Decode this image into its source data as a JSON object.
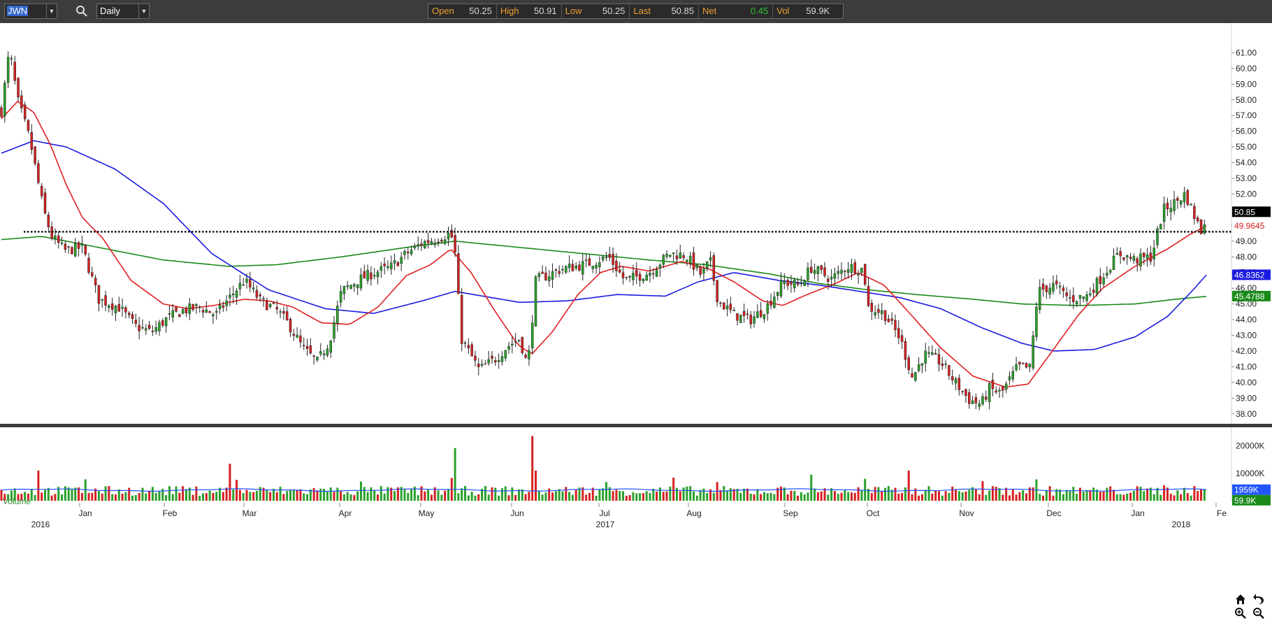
{
  "toolbar": {
    "symbol": "JWN",
    "interval": "Daily",
    "icons": {
      "symbol_dropdown": "chevron-down-icon",
      "search": "search-icon",
      "interval_dropdown": "chevron-down-icon"
    }
  },
  "quote": {
    "open_label": "Open",
    "open": "50.25",
    "high_label": "High",
    "high": "50.91",
    "low_label": "Low",
    "low": "50.25",
    "last_label": "Last",
    "last": "50.85",
    "net_label": "Net",
    "net": "0.45",
    "vol_label": "Vol",
    "vol": "59.9K"
  },
  "colors": {
    "up_candle": "#2aa02a",
    "down_candle": "#d62020",
    "ma_fast": "#e02020",
    "ma_mid": "#1a1ae0",
    "ma_slow": "#1a8a1a",
    "net_positive": "#35c035",
    "volume_avg": "#2255ff"
  },
  "nav": {
    "home": "home-icon",
    "zoom_in": "zoom-in-icon",
    "zoom_out": "zoom-out-icon",
    "undo": "undo-icon"
  },
  "chart_data": {
    "type": "candlestick",
    "ylim": [
      37.5,
      62
    ],
    "yticks": [
      "61.00",
      "60.00",
      "59.00",
      "58.00",
      "57.00",
      "56.00",
      "55.00",
      "54.00",
      "53.00",
      "52.00",
      "51.00",
      "50.00",
      "49.00",
      "48.00",
      "47.00",
      "46.00",
      "45.00",
      "44.00",
      "43.00",
      "42.00",
      "41.00",
      "40.00",
      "39.00",
      "38.00"
    ],
    "date_axis": {
      "months": [
        "Jan",
        "Feb",
        "Mar",
        "Apr",
        "May",
        "Jun",
        "Jul",
        "Aug",
        "Sep",
        "Oct",
        "Nov",
        "Dec",
        "Jan",
        "Fe"
      ],
      "years": [
        "2016",
        "2017",
        "2018"
      ]
    },
    "horizontal_line": 49.6,
    "tags": [
      {
        "value": 50.85,
        "text": "50.85",
        "bg": "#000000",
        "fg": "#ffffff"
      },
      {
        "value": 49.9645,
        "text": "49.9645",
        "bg": "#ffffff",
        "fg": "#d62020"
      },
      {
        "value": 46.8362,
        "text": "46.8362",
        "bg": "#1a1ae0",
        "fg": "#ffffff"
      },
      {
        "value": 45.4788,
        "text": "45.4788",
        "bg": "#1a8a1a",
        "fg": "#ffffff"
      }
    ],
    "price_anchors": [
      {
        "t": 0,
        "c": 57.3
      },
      {
        "t": 10,
        "c": 61.2
      },
      {
        "t": 20,
        "c": 58.0
      },
      {
        "t": 35,
        "c": 55.5
      },
      {
        "t": 52,
        "c": 51.0
      },
      {
        "t": 62,
        "c": 49.3
      },
      {
        "t": 78,
        "c": 48.4
      },
      {
        "t": 100,
        "c": 48.6
      },
      {
        "t": 120,
        "c": 45.3
      },
      {
        "t": 145,
        "c": 44.8
      },
      {
        "t": 165,
        "c": 43.6
      },
      {
        "t": 185,
        "c": 43.2
      },
      {
        "t": 205,
        "c": 44.1
      },
      {
        "t": 225,
        "c": 44.6
      },
      {
        "t": 245,
        "c": 44.8
      },
      {
        "t": 265,
        "c": 44.3
      },
      {
        "t": 285,
        "c": 45.6
      },
      {
        "t": 300,
        "c": 46.5
      },
      {
        "t": 320,
        "c": 45.2
      },
      {
        "t": 340,
        "c": 44.6
      },
      {
        "t": 355,
        "c": 43.7
      },
      {
        "t": 372,
        "c": 42.2
      },
      {
        "t": 390,
        "c": 41.3
      },
      {
        "t": 405,
        "c": 42.6
      },
      {
        "t": 420,
        "c": 45.8
      },
      {
        "t": 440,
        "c": 46.5
      },
      {
        "t": 460,
        "c": 47.0
      },
      {
        "t": 480,
        "c": 47.3
      },
      {
        "t": 500,
        "c": 48.2
      },
      {
        "t": 520,
        "c": 48.9
      },
      {
        "t": 540,
        "c": 49.2
      },
      {
        "t": 555,
        "c": 49.5
      },
      {
        "t": 560,
        "c": 48.4
      },
      {
        "t": 568,
        "c": 42.8
      },
      {
        "t": 590,
        "c": 40.8
      },
      {
        "t": 610,
        "c": 41.5
      },
      {
        "t": 625,
        "c": 42.3
      },
      {
        "t": 640,
        "c": 42.8
      },
      {
        "t": 650,
        "c": 41.0
      },
      {
        "t": 660,
        "c": 46.5
      },
      {
        "t": 690,
        "c": 47.2
      },
      {
        "t": 720,
        "c": 47.5
      },
      {
        "t": 750,
        "c": 48.0
      },
      {
        "t": 770,
        "c": 46.5
      },
      {
        "t": 800,
        "c": 47.0
      },
      {
        "t": 825,
        "c": 48.2
      },
      {
        "t": 845,
        "c": 48.1
      },
      {
        "t": 865,
        "c": 46.8
      },
      {
        "t": 875,
        "c": 47.8
      },
      {
        "t": 885,
        "c": 45.2
      },
      {
        "t": 905,
        "c": 44.3
      },
      {
        "t": 925,
        "c": 44.0
      },
      {
        "t": 945,
        "c": 44.8
      },
      {
        "t": 965,
        "c": 46.4
      },
      {
        "t": 985,
        "c": 46.2
      },
      {
        "t": 1000,
        "c": 47.3
      },
      {
        "t": 1025,
        "c": 46.6
      },
      {
        "t": 1045,
        "c": 47.4
      },
      {
        "t": 1065,
        "c": 47.2
      },
      {
        "t": 1070,
        "c": 44.8
      },
      {
        "t": 1090,
        "c": 44.4
      },
      {
        "t": 1110,
        "c": 42.8
      },
      {
        "t": 1125,
        "c": 40.3
      },
      {
        "t": 1140,
        "c": 41.8
      },
      {
        "t": 1160,
        "c": 41.3
      },
      {
        "t": 1175,
        "c": 40.2
      },
      {
        "t": 1195,
        "c": 38.9
      },
      {
        "t": 1210,
        "c": 38.6
      },
      {
        "t": 1220,
        "c": 39.6
      },
      {
        "t": 1235,
        "c": 39.3
      },
      {
        "t": 1255,
        "c": 41.0
      },
      {
        "t": 1270,
        "c": 40.9
      },
      {
        "t": 1280,
        "c": 45.8
      },
      {
        "t": 1300,
        "c": 46.2
      },
      {
        "t": 1320,
        "c": 45.3
      },
      {
        "t": 1340,
        "c": 45.5
      },
      {
        "t": 1360,
        "c": 46.8
      },
      {
        "t": 1380,
        "c": 48.2
      },
      {
        "t": 1400,
        "c": 47.8
      },
      {
        "t": 1420,
        "c": 48.0
      },
      {
        "t": 1435,
        "c": 51.0
      },
      {
        "t": 1450,
        "c": 51.5
      },
      {
        "t": 1462,
        "c": 52.0
      },
      {
        "t": 1475,
        "c": 50.4
      },
      {
        "t": 1482,
        "c": 49.6
      },
      {
        "t": 1488,
        "c": 50.85
      }
    ],
    "ma_fast": [
      {
        "t": 0,
        "v": 56.8
      },
      {
        "t": 20,
        "v": 57.9
      },
      {
        "t": 40,
        "v": 57.2
      },
      {
        "t": 60,
        "v": 55.2
      },
      {
        "t": 80,
        "v": 52.6
      },
      {
        "t": 100,
        "v": 50.5
      },
      {
        "t": 125,
        "v": 49.2
      },
      {
        "t": 160,
        "v": 46.5
      },
      {
        "t": 200,
        "v": 45.0
      },
      {
        "t": 230,
        "v": 44.7
      },
      {
        "t": 262,
        "v": 44.9
      },
      {
        "t": 300,
        "v": 45.3
      },
      {
        "t": 330,
        "v": 45.2
      },
      {
        "t": 360,
        "v": 44.8
      },
      {
        "t": 395,
        "v": 43.8
      },
      {
        "t": 430,
        "v": 43.7
      },
      {
        "t": 465,
        "v": 44.8
      },
      {
        "t": 500,
        "v": 46.8
      },
      {
        "t": 530,
        "v": 47.5
      },
      {
        "t": 555,
        "v": 48.5
      },
      {
        "t": 580,
        "v": 47.0
      },
      {
        "t": 610,
        "v": 44.5
      },
      {
        "t": 638,
        "v": 42.4
      },
      {
        "t": 655,
        "v": 41.8
      },
      {
        "t": 680,
        "v": 43.2
      },
      {
        "t": 712,
        "v": 45.6
      },
      {
        "t": 740,
        "v": 47.0
      },
      {
        "t": 765,
        "v": 47.4
      },
      {
        "t": 800,
        "v": 47.1
      },
      {
        "t": 840,
        "v": 47.7
      },
      {
        "t": 875,
        "v": 47.2
      },
      {
        "t": 905,
        "v": 46.4
      },
      {
        "t": 940,
        "v": 45.2
      },
      {
        "t": 965,
        "v": 44.9
      },
      {
        "t": 995,
        "v": 45.6
      },
      {
        "t": 1030,
        "v": 46.3
      },
      {
        "t": 1058,
        "v": 47.0
      },
      {
        "t": 1090,
        "v": 46.2
      },
      {
        "t": 1120,
        "v": 44.5
      },
      {
        "t": 1160,
        "v": 42.2
      },
      {
        "t": 1200,
        "v": 40.4
      },
      {
        "t": 1240,
        "v": 39.7
      },
      {
        "t": 1268,
        "v": 39.9
      },
      {
        "t": 1295,
        "v": 41.8
      },
      {
        "t": 1330,
        "v": 44.3
      },
      {
        "t": 1360,
        "v": 46.0
      },
      {
        "t": 1400,
        "v": 47.4
      },
      {
        "t": 1440,
        "v": 48.5
      },
      {
        "t": 1470,
        "v": 49.5
      },
      {
        "t": 1488,
        "v": 49.96
      }
    ],
    "ma_mid": [
      {
        "t": 0,
        "v": 54.6
      },
      {
        "t": 40,
        "v": 55.4
      },
      {
        "t": 80,
        "v": 55.0
      },
      {
        "t": 140,
        "v": 53.6
      },
      {
        "t": 200,
        "v": 51.4
      },
      {
        "t": 260,
        "v": 48.2
      },
      {
        "t": 330,
        "v": 45.9
      },
      {
        "t": 400,
        "v": 44.7
      },
      {
        "t": 460,
        "v": 44.4
      },
      {
        "t": 520,
        "v": 45.2
      },
      {
        "t": 560,
        "v": 45.8
      },
      {
        "t": 640,
        "v": 45.1
      },
      {
        "t": 700,
        "v": 45.2
      },
      {
        "t": 760,
        "v": 45.6
      },
      {
        "t": 820,
        "v": 45.5
      },
      {
        "t": 860,
        "v": 46.4
      },
      {
        "t": 905,
        "v": 47.0
      },
      {
        "t": 960,
        "v": 46.5
      },
      {
        "t": 1010,
        "v": 46.2
      },
      {
        "t": 1060,
        "v": 45.8
      },
      {
        "t": 1110,
        "v": 45.4
      },
      {
        "t": 1160,
        "v": 44.7
      },
      {
        "t": 1210,
        "v": 43.5
      },
      {
        "t": 1260,
        "v": 42.5
      },
      {
        "t": 1300,
        "v": 42.0
      },
      {
        "t": 1350,
        "v": 42.1
      },
      {
        "t": 1400,
        "v": 42.9
      },
      {
        "t": 1440,
        "v": 44.2
      },
      {
        "t": 1470,
        "v": 45.8
      },
      {
        "t": 1488,
        "v": 46.84
      }
    ],
    "ma_slow": [
      {
        "t": 0,
        "v": 49.1
      },
      {
        "t": 50,
        "v": 49.3
      },
      {
        "t": 120,
        "v": 48.6
      },
      {
        "t": 200,
        "v": 47.8
      },
      {
        "t": 280,
        "v": 47.4
      },
      {
        "t": 340,
        "v": 47.5
      },
      {
        "t": 420,
        "v": 48.0
      },
      {
        "t": 500,
        "v": 48.6
      },
      {
        "t": 560,
        "v": 49.0
      },
      {
        "t": 640,
        "v": 48.6
      },
      {
        "t": 720,
        "v": 48.2
      },
      {
        "t": 800,
        "v": 47.8
      },
      {
        "t": 870,
        "v": 47.5
      },
      {
        "t": 950,
        "v": 46.9
      },
      {
        "t": 1010,
        "v": 46.3
      },
      {
        "t": 1070,
        "v": 45.9
      },
      {
        "t": 1130,
        "v": 45.6
      },
      {
        "t": 1200,
        "v": 45.3
      },
      {
        "t": 1260,
        "v": 45.0
      },
      {
        "t": 1330,
        "v": 44.9
      },
      {
        "t": 1400,
        "v": 45.0
      },
      {
        "t": 1450,
        "v": 45.3
      },
      {
        "t": 1488,
        "v": 45.48
      }
    ],
    "volume": {
      "title": "Volume",
      "yticks": [
        "20000K",
        "10000K"
      ],
      "ylim": [
        0,
        25000
      ],
      "base_level": 4000,
      "avg_level": 3900,
      "spikes": [
        {
          "t": 45,
          "v": 11000
        },
        {
          "t": 105,
          "v": 7800
        },
        {
          "t": 215,
          "v": 5200
        },
        {
          "t": 282,
          "v": 13500
        },
        {
          "t": 290,
          "v": 7600
        },
        {
          "t": 395,
          "v": 4400
        },
        {
          "t": 442,
          "v": 7000
        },
        {
          "t": 555,
          "v": 8300
        },
        {
          "t": 562,
          "v": 19200
        },
        {
          "t": 655,
          "v": 23600
        },
        {
          "t": 660,
          "v": 11000
        },
        {
          "t": 745,
          "v": 6800
        },
        {
          "t": 830,
          "v": 8400
        },
        {
          "t": 885,
          "v": 6800
        },
        {
          "t": 1000,
          "v": 9500
        },
        {
          "t": 1068,
          "v": 8000
        },
        {
          "t": 1120,
          "v": 11000
        },
        {
          "t": 1212,
          "v": 7100
        },
        {
          "t": 1280,
          "v": 7800
        },
        {
          "t": 1435,
          "v": 5600
        }
      ],
      "tags": [
        {
          "value": 3900,
          "text": "1959K",
          "bg": "#2255ff",
          "fg": "#ffffff"
        },
        {
          "value": 60,
          "text": "59.9K",
          "bg": "#1a8a1a",
          "fg": "#ffffff"
        }
      ]
    }
  }
}
